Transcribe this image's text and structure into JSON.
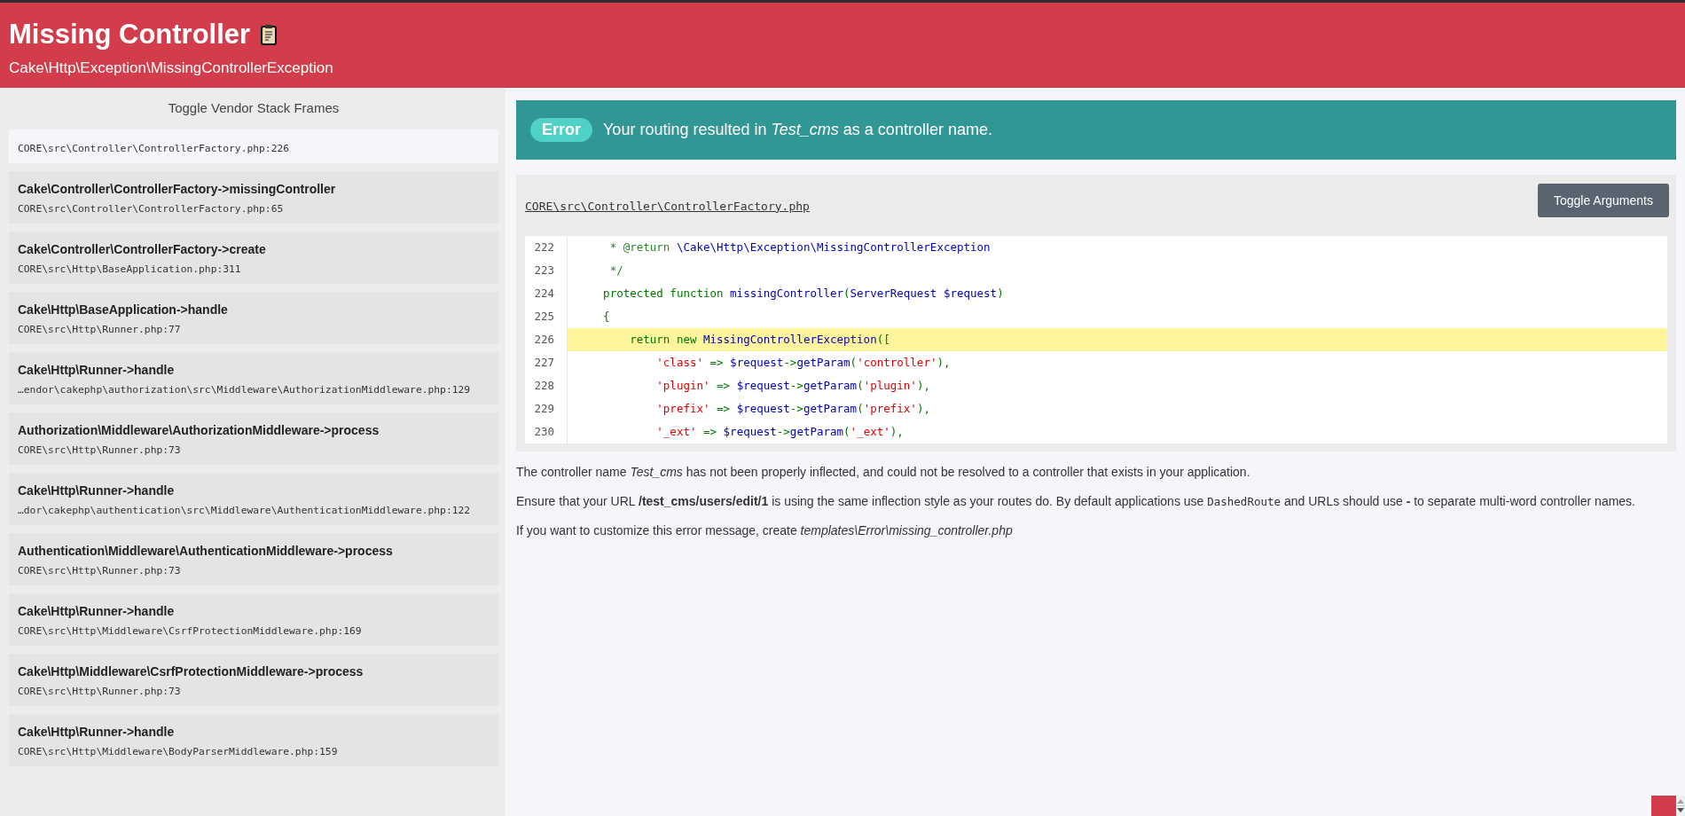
{
  "header": {
    "title": "Missing Controller",
    "exception": "Cake\\Http\\Exception\\MissingControllerException"
  },
  "sidebar": {
    "toggle": "Toggle Vendor Stack Frames",
    "frames": [
      {
        "file": "CORE\\src\\Controller\\ControllerFactory.php:226",
        "selected": true
      },
      {
        "function": "Cake\\Controller\\ControllerFactory->missingController",
        "file": "CORE\\src\\Controller\\ControllerFactory.php:65",
        "selected": false
      },
      {
        "function": "Cake\\Controller\\ControllerFactory->create",
        "file": "CORE\\src\\Http\\BaseApplication.php:311",
        "selected": false
      },
      {
        "function": "Cake\\Http\\BaseApplication->handle",
        "file": "CORE\\src\\Http\\Runner.php:77",
        "selected": false
      },
      {
        "function": "Cake\\Http\\Runner->handle",
        "file": "…endor\\cakephp\\authorization\\src\\Middleware\\AuthorizationMiddleware.php:129",
        "selected": false
      },
      {
        "function": "Authorization\\Middleware\\AuthorizationMiddleware->process",
        "file": "CORE\\src\\Http\\Runner.php:73",
        "selected": false
      },
      {
        "function": "Cake\\Http\\Runner->handle",
        "file": "…dor\\cakephp\\authentication\\src\\Middleware\\AuthenticationMiddleware.php:122",
        "selected": false
      },
      {
        "function": "Authentication\\Middleware\\AuthenticationMiddleware->process",
        "file": "CORE\\src\\Http\\Runner.php:73",
        "selected": false
      },
      {
        "function": "Cake\\Http\\Runner->handle",
        "file": "CORE\\src\\Http\\Middleware\\CsrfProtectionMiddleware.php:169",
        "selected": false
      },
      {
        "function": "Cake\\Http\\Middleware\\CsrfProtectionMiddleware->process",
        "file": "CORE\\src\\Http\\Runner.php:73",
        "selected": false
      },
      {
        "function": "Cake\\Http\\Runner->handle",
        "file": "CORE\\src\\Http\\Middleware\\BodyParserMiddleware.php:159",
        "selected": false
      }
    ]
  },
  "banner": {
    "badge": "Error",
    "message": "Your routing resulted in *Test_cms* as a controller name."
  },
  "code_panel": {
    "file": "CORE\\src\\Controller\\ControllerFactory.php",
    "button": "Toggle Arguments",
    "lines": [
      {
        "number": "222",
        "highlighted": false,
        "tokens": [
          {
            "kind": "comment",
            "text": "     * @return "
          },
          {
            "kind": "name",
            "text": "\\Cake\\Http\\Exception\\MissingControllerException"
          }
        ]
      },
      {
        "number": "223",
        "highlighted": false,
        "tokens": [
          {
            "kind": "comment",
            "text": "     */"
          }
        ]
      },
      {
        "number": "224",
        "highlighted": false,
        "tokens": [
          {
            "kind": "keyword",
            "text": "    protected function "
          },
          {
            "kind": "name",
            "text": "missingController"
          },
          {
            "kind": "keyword",
            "text": "("
          },
          {
            "kind": "name",
            "text": "ServerRequest $request"
          },
          {
            "kind": "keyword",
            "text": ")"
          }
        ]
      },
      {
        "number": "225",
        "highlighted": false,
        "tokens": [
          {
            "kind": "keyword",
            "text": "    {"
          }
        ]
      },
      {
        "number": "226",
        "highlighted": true,
        "tokens": [
          {
            "kind": "keyword",
            "text": "        return new "
          },
          {
            "kind": "name",
            "text": "MissingControllerException"
          },
          {
            "kind": "keyword",
            "text": "(["
          }
        ]
      },
      {
        "number": "227",
        "highlighted": false,
        "tokens": [
          {
            "kind": "string",
            "text": "            'class'"
          },
          {
            "kind": "keyword",
            "text": " => "
          },
          {
            "kind": "name",
            "text": "$request"
          },
          {
            "kind": "keyword",
            "text": "->"
          },
          {
            "kind": "name",
            "text": "getParam"
          },
          {
            "kind": "keyword",
            "text": "("
          },
          {
            "kind": "string",
            "text": "'controller'"
          },
          {
            "kind": "keyword",
            "text": "),"
          }
        ]
      },
      {
        "number": "228",
        "highlighted": false,
        "tokens": [
          {
            "kind": "string",
            "text": "            'plugin'"
          },
          {
            "kind": "keyword",
            "text": " => "
          },
          {
            "kind": "name",
            "text": "$request"
          },
          {
            "kind": "keyword",
            "text": "->"
          },
          {
            "kind": "name",
            "text": "getParam"
          },
          {
            "kind": "keyword",
            "text": "("
          },
          {
            "kind": "string",
            "text": "'plugin'"
          },
          {
            "kind": "keyword",
            "text": "),"
          }
        ]
      },
      {
        "number": "229",
        "highlighted": false,
        "tokens": [
          {
            "kind": "string",
            "text": "            'prefix'"
          },
          {
            "kind": "keyword",
            "text": " => "
          },
          {
            "kind": "name",
            "text": "$request"
          },
          {
            "kind": "keyword",
            "text": "->"
          },
          {
            "kind": "name",
            "text": "getParam"
          },
          {
            "kind": "keyword",
            "text": "("
          },
          {
            "kind": "string",
            "text": "'prefix'"
          },
          {
            "kind": "keyword",
            "text": "),"
          }
        ]
      },
      {
        "number": "230",
        "highlighted": false,
        "tokens": [
          {
            "kind": "string",
            "text": "            '_ext'"
          },
          {
            "kind": "keyword",
            "text": " => "
          },
          {
            "kind": "name",
            "text": "$request"
          },
          {
            "kind": "keyword",
            "text": "->"
          },
          {
            "kind": "name",
            "text": "getParam"
          },
          {
            "kind": "keyword",
            "text": "("
          },
          {
            "kind": "string",
            "text": "'_ext'"
          },
          {
            "kind": "keyword",
            "text": "),"
          }
        ]
      }
    ]
  },
  "paragraphs": [
    [
      {
        "kind": "text",
        "text": "The controller name *Test_cms* has not been properly inflected, and could not be resolved to a controller that exists in your application."
      }
    ],
    [
      {
        "kind": "text",
        "text": "Ensure that your URL **/test_cms/users/edit/1** is using the same inflection style as your routes do. By default applications use "
      },
      {
        "kind": "code",
        "text": "DashedRoute"
      },
      {
        "kind": "text",
        "text": " and URLs should use **-** to separate multi-word controller names."
      }
    ],
    [
      {
        "kind": "text",
        "text": "If you want to customize this error message, create *templates\\Error\\missing_controller.php*"
      }
    ]
  ]
}
